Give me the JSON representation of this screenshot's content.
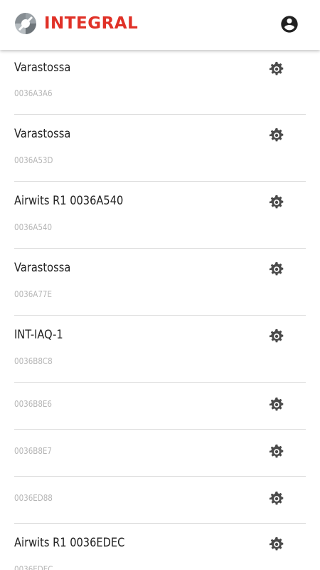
{
  "header": {
    "brand": "INTEGRAL",
    "brand_color": "#e03127",
    "logo_icon": "integral-logo-icon",
    "account_icon": "account-circle-icon"
  },
  "devices": [
    {
      "name": "Varastossa",
      "id": "0036A3A6",
      "settings_icon": "gear-icon"
    },
    {
      "name": "Varastossa",
      "id": "0036A53D",
      "settings_icon": "gear-icon"
    },
    {
      "name": "Airwits R1 0036A540",
      "id": "0036A540",
      "settings_icon": "gear-icon"
    },
    {
      "name": "Varastossa",
      "id": "0036A77E",
      "settings_icon": "gear-icon"
    },
    {
      "name": "INT-IAQ-1",
      "id": "0036B8C8",
      "settings_icon": "gear-icon"
    },
    {
      "name": "",
      "id": "0036B8E6",
      "settings_icon": "gear-icon"
    },
    {
      "name": "",
      "id": "0036B8E7",
      "settings_icon": "gear-icon"
    },
    {
      "name": "",
      "id": "0036ED88",
      "settings_icon": "gear-icon"
    },
    {
      "name": "Airwits R1 0036EDEC",
      "id": "0036EDEC",
      "settings_icon": "gear-icon"
    }
  ]
}
